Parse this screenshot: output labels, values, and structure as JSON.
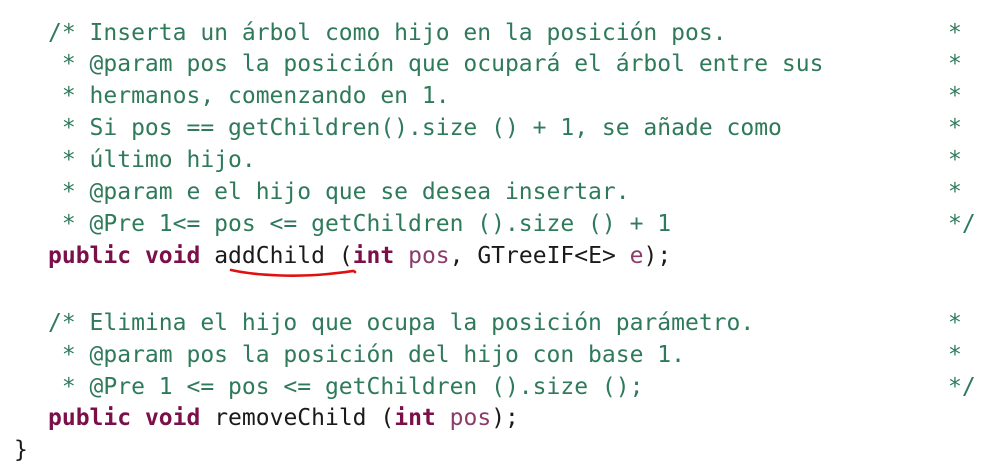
{
  "code_block_1": {
    "comment_lines": [
      "/* Inserta un árbol como hijo en la posición pos.",
      " * @param pos la posición que ocupará el árbol entre sus",
      " * hermanos, comenzando en 1.",
      " * Si pos == getChildren().size () + 1, se añade como",
      " * último hijo.",
      " * @param e el hijo que se desea insertar.",
      " * @Pre 1<= pos <= getChildren ().size () + 1"
    ],
    "comment_right_marks": [
      "*",
      "*",
      "*",
      "*",
      "*",
      "*",
      "*/"
    ],
    "signature": {
      "kw1": "public",
      "kw2": "void",
      "method": "addChild",
      "open": " (",
      "ptype": "int",
      "pname": "pos",
      "sep": ", GTreeIF<E> ",
      "pname2": "e",
      "close": ");"
    }
  },
  "code_block_2": {
    "comment_lines": [
      "/* Elimina el hijo que ocupa la posición parámetro.",
      " * @param pos la posición del hijo con base 1.",
      " * @Pre 1 <= pos <= getChildren ().size ();"
    ],
    "comment_right_marks": [
      "*",
      "*",
      "*/"
    ],
    "signature": {
      "kw1": "public",
      "kw2": "void",
      "method": "removeChild",
      "open": " (",
      "ptype": "int",
      "pname": "pos",
      "close": ");"
    }
  },
  "closing_brace": "}",
  "colors": {
    "comment": "#2f7a5b",
    "keyword": "#7a0f4a",
    "parameter": "#8a3d6a",
    "text": "#1a1a1a",
    "annotation_underline": "#e01010"
  }
}
